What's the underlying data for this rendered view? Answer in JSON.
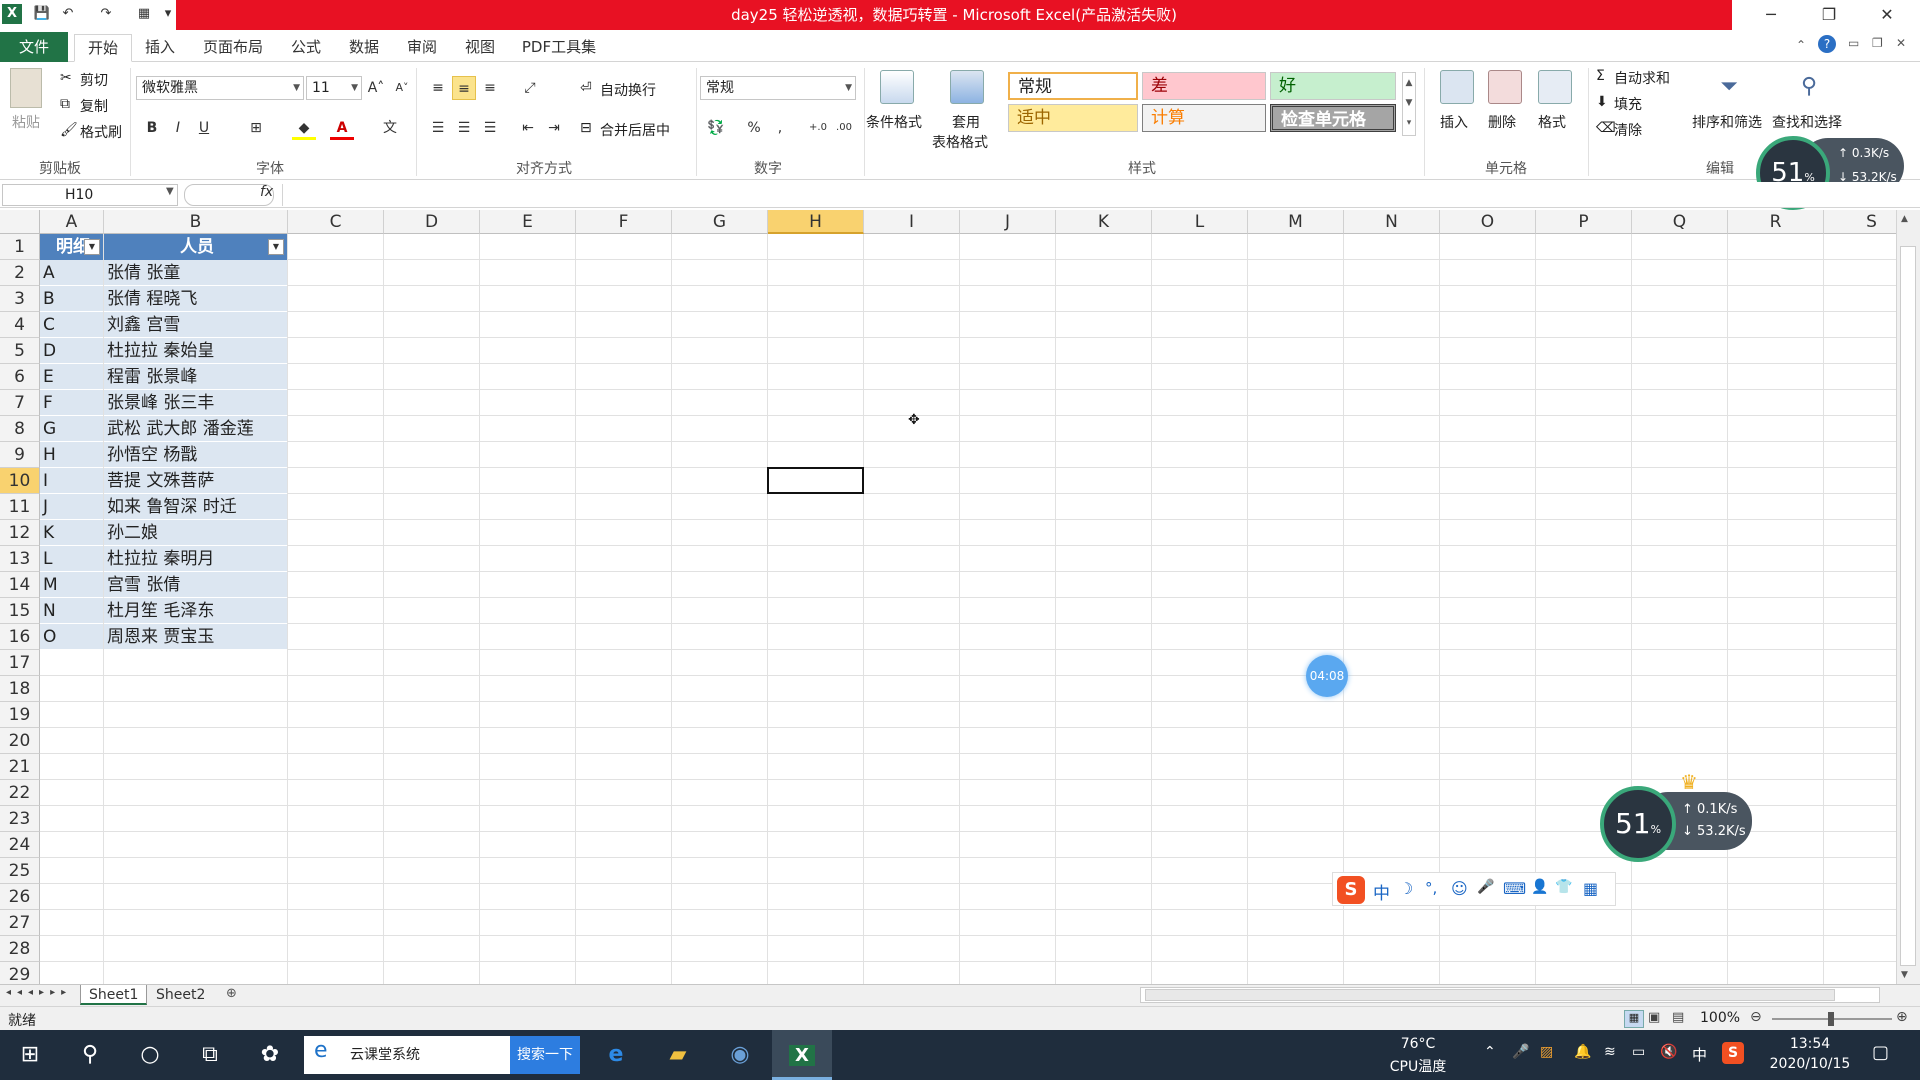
{
  "window": {
    "title": "day25 轻松逆透视，数据巧转置 - Microsoft Excel(产品激活失败)",
    "controls": {
      "minimize": "─",
      "restore": "❐",
      "close": "✕"
    }
  },
  "ribbon_tabs": [
    "文件",
    "开始",
    "插入",
    "页面布局",
    "公式",
    "数据",
    "审阅",
    "视图",
    "PDF工具集"
  ],
  "active_tab": "开始",
  "clipboard": {
    "paste": "粘贴",
    "cut": "剪切",
    "copy": "复制",
    "format_painter": "格式刷",
    "label": "剪贴板"
  },
  "font": {
    "name": "微软雅黑",
    "size": "11",
    "label": "字体",
    "bold": "B",
    "italic": "I",
    "underline": "U",
    "grow": "A˄",
    "shrink": "A˅"
  },
  "alignment": {
    "wrap": "自动换行",
    "merge": "合并后居中",
    "label": "对齐方式"
  },
  "number": {
    "format": "常规",
    "label": "数字",
    "percent": "%",
    "comma": ","
  },
  "styles": {
    "conditional": "条件格式",
    "table_format_line1": "套用",
    "table_format_line2": "表格格式",
    "label": "样式",
    "cells": [
      {
        "text": "常规",
        "bg": "#ffffff",
        "fg": "#000000"
      },
      {
        "text": "差",
        "bg": "#ffc7ce",
        "fg": "#9c0006"
      },
      {
        "text": "好",
        "bg": "#c6efce",
        "fg": "#006100"
      },
      {
        "text": "适中",
        "bg": "#ffeb9c",
        "fg": "#9c6500"
      },
      {
        "text": "计算",
        "bg": "#f2f2f2",
        "fg": "#fa7d00"
      },
      {
        "text": "检查单元格",
        "bg": "#a5a5a5",
        "fg": "#ffffff"
      }
    ]
  },
  "cells_group": {
    "insert": "插入",
    "delete": "删除",
    "format": "格式",
    "label": "单元格"
  },
  "editing": {
    "autosum": "自动求和",
    "fill": "填充",
    "clear": "清除",
    "sort": "排序和筛选",
    "find": "查找和选择",
    "label": "编辑"
  },
  "formula_bar": {
    "name_box": "H10",
    "fx": "fx",
    "value": ""
  },
  "columns": [
    "A",
    "B",
    "C",
    "D",
    "E",
    "F",
    "G",
    "H",
    "I",
    "J",
    "K",
    "L",
    "M",
    "N",
    "O",
    "P",
    "Q",
    "R",
    "S"
  ],
  "rows": [
    "1",
    "2",
    "3",
    "4",
    "5",
    "6",
    "7",
    "8",
    "9",
    "10",
    "11",
    "12",
    "13",
    "14",
    "15",
    "16",
    "17",
    "18",
    "19",
    "20",
    "21",
    "22",
    "23",
    "24",
    "25",
    "26",
    "27",
    "28",
    "29"
  ],
  "selected": {
    "column": "H",
    "row": "10"
  },
  "table": {
    "headers": [
      "明细",
      "人员"
    ],
    "header_color": "#4f81bd",
    "band_color": "#dce6f1",
    "rows": [
      [
        "A",
        "张倩 张童"
      ],
      [
        "B",
        "张倩 程晓飞"
      ],
      [
        "C",
        "刘鑫 宫雪"
      ],
      [
        "D",
        "杜拉拉 秦始皇"
      ],
      [
        "E",
        "程雷 张景峰"
      ],
      [
        "F",
        "张景峰 张三丰"
      ],
      [
        "G",
        "武松 武大郎 潘金莲"
      ],
      [
        "H",
        "孙悟空 杨戬"
      ],
      [
        "I",
        "菩提 文殊菩萨"
      ],
      [
        "J",
        "如来 鲁智深 时迁"
      ],
      [
        "K",
        "孙二娘"
      ],
      [
        "L",
        "杜拉拉 秦明月"
      ],
      [
        "M",
        "宫雪 张倩"
      ],
      [
        "N",
        "杜月笙 毛泽东"
      ],
      [
        "O",
        "周恩来 贾宝玉"
      ]
    ]
  },
  "sheets": [
    "Sheet1",
    "Sheet2"
  ],
  "active_sheet": "Sheet1",
  "status": {
    "ready": "就绪",
    "zoom": "100%"
  },
  "widgets": {
    "gauge_top": {
      "value": "51",
      "unit": "%",
      "up": "0.3",
      "down": "53.2",
      "rate_unit": "K/s"
    },
    "gauge_bottom": {
      "value": "51",
      "unit": "%",
      "up": "0.1",
      "down": "53.2",
      "rate_unit": "K/s"
    },
    "timer": "04:08",
    "ime_items": [
      "S",
      "中",
      "☽",
      "°,",
      "☺",
      "🎤",
      "⌨",
      "👤",
      "👕",
      "▦"
    ]
  },
  "taskbar": {
    "search_text": "云课堂系统",
    "search_button": "搜索一下",
    "temp": "76°C",
    "temp_label": "CPU温度",
    "ime": "中",
    "time": "13:54",
    "date": "2020/10/15"
  }
}
